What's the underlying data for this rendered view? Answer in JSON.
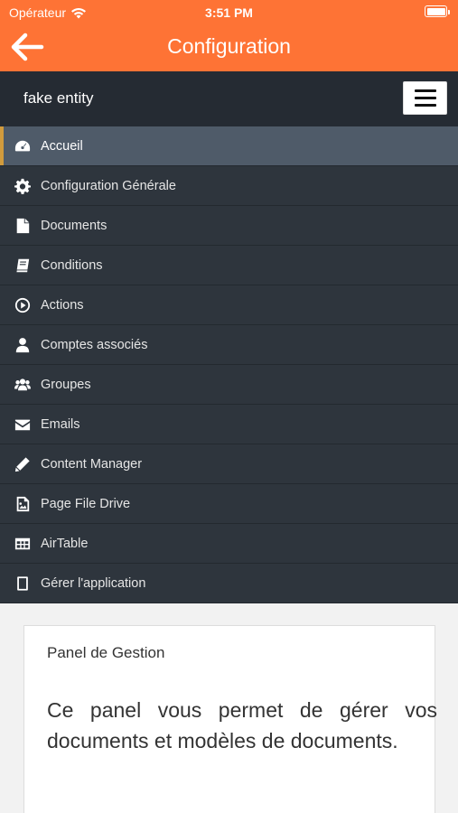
{
  "status_bar": {
    "carrier": "Opérateur",
    "time": "3:51 PM"
  },
  "header": {
    "title": "Configuration"
  },
  "entity": {
    "name": "fake entity"
  },
  "nav": {
    "items": [
      {
        "label": "Accueil",
        "icon": "dashboard-icon",
        "active": true
      },
      {
        "label": "Configuration Générale",
        "icon": "gear-icon"
      },
      {
        "label": "Documents",
        "icon": "file-icon"
      },
      {
        "label": "Conditions",
        "icon": "book-icon"
      },
      {
        "label": "Actions",
        "icon": "play-circle-icon"
      },
      {
        "label": "Comptes associés",
        "icon": "user-icon"
      },
      {
        "label": "Groupes",
        "icon": "users-icon"
      },
      {
        "label": "Emails",
        "icon": "envelope-icon"
      },
      {
        "label": "Content Manager",
        "icon": "pencil-icon"
      },
      {
        "label": "Page File Drive",
        "icon": "image-file-icon"
      },
      {
        "label": "AirTable",
        "icon": "table-icon"
      },
      {
        "label": "Gérer l'application",
        "icon": "tablet-icon"
      }
    ]
  },
  "panel": {
    "title": "Panel de Gestion",
    "text": "Ce panel vous permet de gérer vos documents et modèles de documents."
  },
  "colors": {
    "accent": "#fe7335",
    "nav_bg": "#2e353d",
    "nav_active": "#4f5b69",
    "active_marker": "#d19b3d"
  }
}
